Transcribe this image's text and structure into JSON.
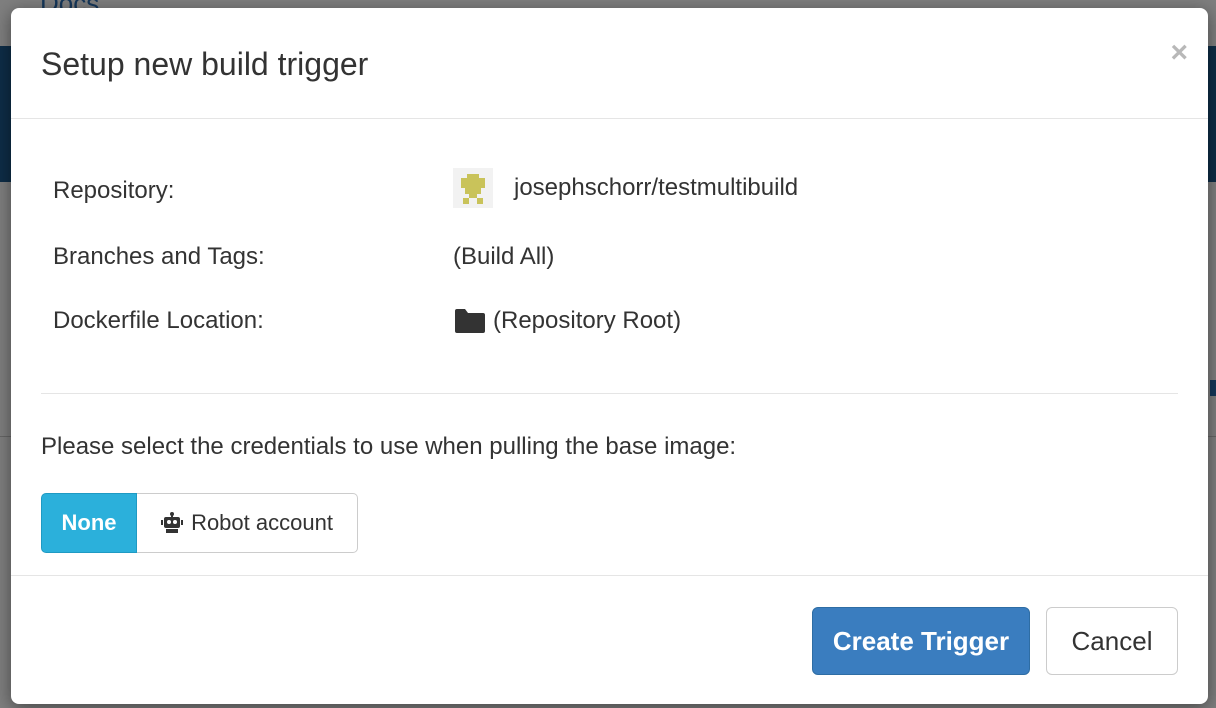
{
  "background": {
    "docs_link": "Docs"
  },
  "modal": {
    "title": "Setup new build trigger",
    "close_symbol": "×",
    "details": {
      "repository_label": "Repository:",
      "repository_value": "josephschorr/testmultibuild",
      "repository_avatar_icon": "identicon-avatar",
      "branches_label": "Branches and Tags:",
      "branches_value": "(Build All)",
      "dockerfile_label": "Dockerfile Location:",
      "dockerfile_value": "(Repository Root)",
      "dockerfile_icon": "folder-icon"
    },
    "credentials_prompt": "Please select the credentials to use when pulling the base image:",
    "credentials_options": {
      "none_label": "None",
      "robot_label": "Robot account",
      "robot_icon": "robot-icon",
      "selected": "None"
    },
    "footer": {
      "create_label": "Create Trigger",
      "cancel_label": "Cancel"
    }
  },
  "colors": {
    "primary": "#3a7dbf",
    "selected_toggle": "#2bb0db",
    "navbar": "#1d5a8e",
    "avatar_accent": "#c9c35a"
  }
}
